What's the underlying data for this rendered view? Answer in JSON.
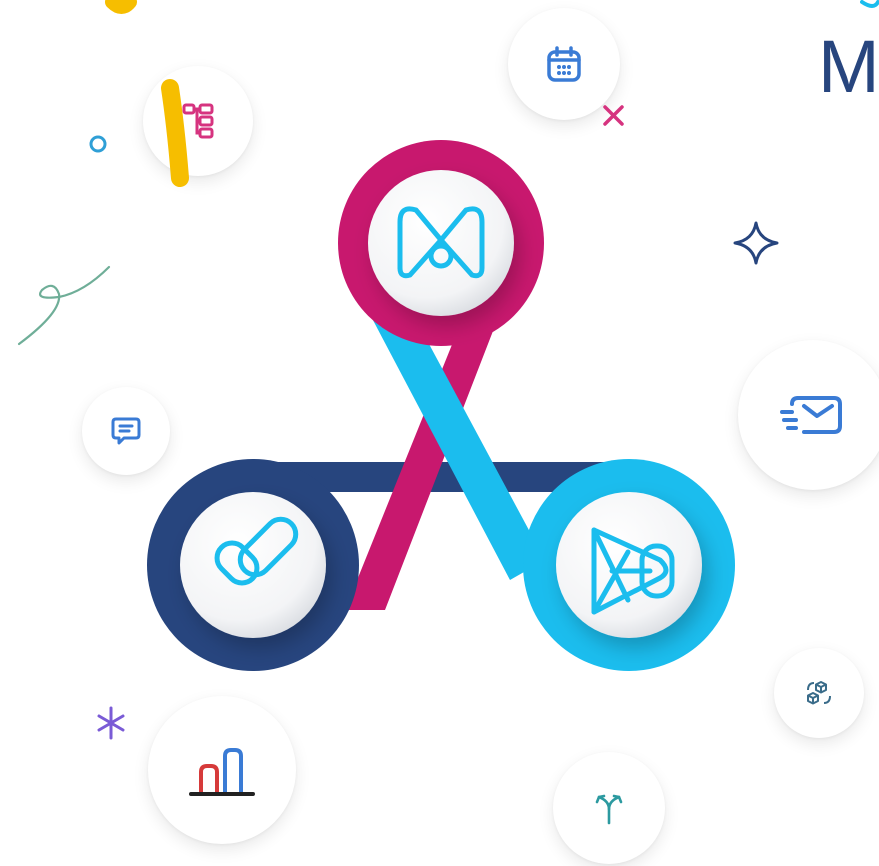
{
  "brand": {
    "letter": "M"
  },
  "colors": {
    "magenta": "#c8186e",
    "navy": "#27457e",
    "cyan": "#1bbdee",
    "yellow": "#f6be00",
    "icon_blue": "#3a7bd5",
    "icon_pink": "#d6337f",
    "icon_teal": "#2c9aa0"
  },
  "hub": {
    "nodes": [
      {
        "name": "top-node",
        "icon": "m-logo-icon",
        "color": "magenta"
      },
      {
        "name": "left-node",
        "icon": "heart-link-icon",
        "color": "navy"
      },
      {
        "name": "right-node",
        "icon": "play-shape-icon",
        "color": "cyan"
      }
    ]
  },
  "satellites": [
    {
      "icon": "org-chart-icon"
    },
    {
      "icon": "calendar-icon"
    },
    {
      "icon": "chat-icon"
    },
    {
      "icon": "email-icon"
    },
    {
      "icon": "bar-chart-icon"
    },
    {
      "icon": "merge-arrow-icon"
    },
    {
      "icon": "cube-sync-icon"
    }
  ]
}
